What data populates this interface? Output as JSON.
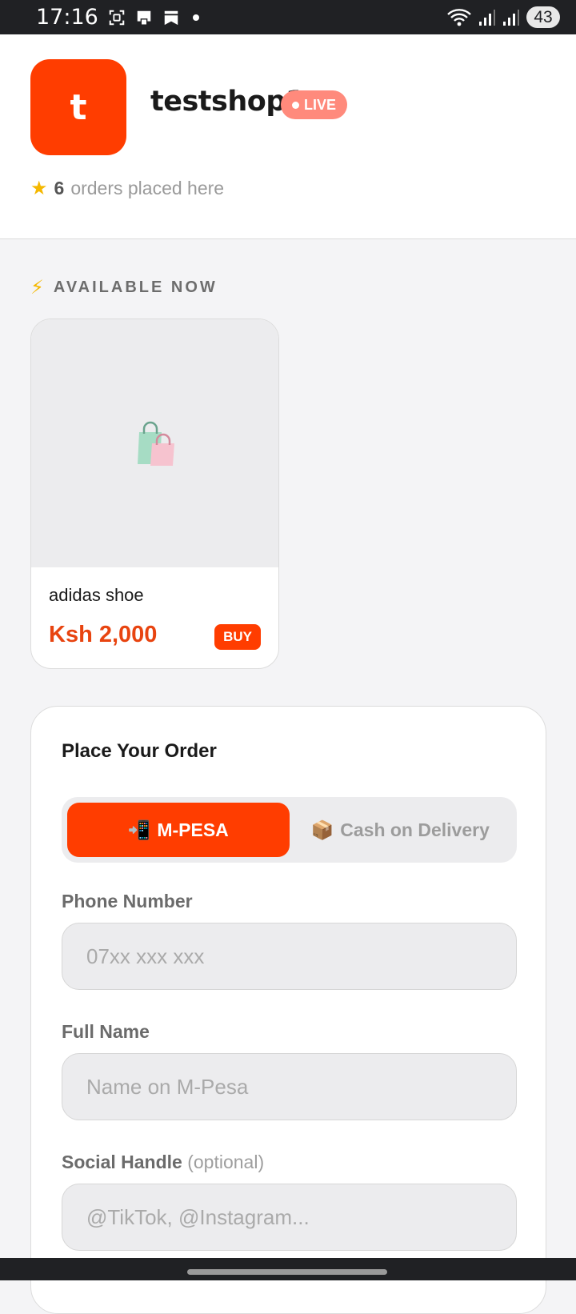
{
  "status_bar": {
    "time": "17:16",
    "battery": "43",
    "icons": [
      "screenshot-icon",
      "sim-icon",
      "bookmark-icon",
      "dot-icon",
      "wifi-icon",
      "signal-icon",
      "signal-icon"
    ]
  },
  "shop": {
    "logo_letter": "t",
    "name": "testshop1",
    "live_badge": "LIVE",
    "orders_count": "6",
    "orders_text": "orders placed here",
    "accent_color": "#ff3d00"
  },
  "available": {
    "title": "AVAILABLE NOW",
    "products": [
      {
        "name": "adidas shoe",
        "price": "Ksh 2,000",
        "buy_label": "BUY",
        "image_icon": "shopping-bags-icon"
      }
    ]
  },
  "order_form": {
    "title": "Place Your Order",
    "payment_options": [
      {
        "label": "M-PESA",
        "icon": "📲",
        "selected": true
      },
      {
        "label": "Cash on Delivery",
        "icon": "📦",
        "selected": false
      }
    ],
    "fields": {
      "phone": {
        "label": "Phone Number",
        "placeholder": "07xx xxx xxx",
        "value": ""
      },
      "name": {
        "label": "Full Name",
        "placeholder": "Name on M-Pesa",
        "value": ""
      },
      "social": {
        "label": "Social Handle",
        "optional": "(optional)",
        "placeholder": "@TikTok, @Instagram...",
        "value": ""
      }
    }
  }
}
